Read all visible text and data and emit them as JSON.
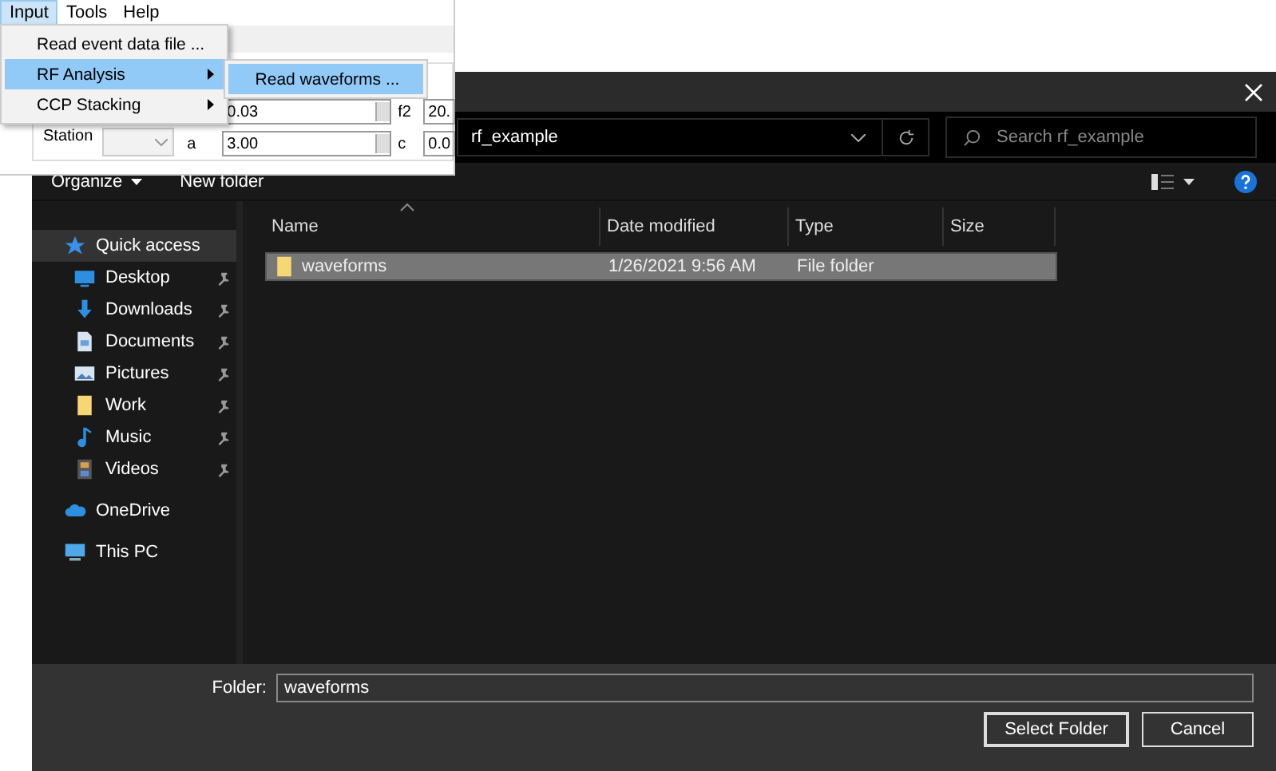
{
  "app_window": {
    "menu_bar": [
      {
        "label": "Input",
        "selected": true
      },
      {
        "label": "Tools",
        "selected": false
      },
      {
        "label": "Help",
        "selected": false
      }
    ],
    "station": {
      "label": "Station",
      "disabled": true
    },
    "fields": [
      {
        "value": "0.03"
      },
      {
        "label": "f2",
        "value": "20."
      },
      {
        "label": "a",
        "value": "3.00"
      },
      {
        "label": "c",
        "value": "0.0"
      }
    ]
  },
  "input_menu": {
    "items": [
      {
        "label": "Read event data file ...",
        "selected": false,
        "submenu": false
      },
      {
        "label": "RF Analysis",
        "selected": true,
        "submenu": true
      },
      {
        "label": "CCP Stacking",
        "selected": false,
        "submenu": true
      }
    ],
    "submenu_items": [
      {
        "label": "Read waveforms ...",
        "selected": true
      }
    ]
  },
  "dialog": {
    "address": "rf_example",
    "search": {
      "placeholder": "Search rf_example"
    },
    "toolbar": [
      {
        "label": "Organize",
        "kind": "dropdown"
      },
      {
        "label": "New folder",
        "kind": "button"
      }
    ],
    "sidebar": [
      {
        "label": "Quick access",
        "kind": "section",
        "selected": true,
        "pinned": false
      },
      {
        "label": "Desktop",
        "kind": "item",
        "selected": false,
        "pinned": true
      },
      {
        "label": "Downloads",
        "kind": "item",
        "selected": false,
        "pinned": true
      },
      {
        "label": "Documents",
        "kind": "item",
        "selected": false,
        "pinned": true
      },
      {
        "label": "Pictures",
        "kind": "item",
        "selected": false,
        "pinned": true
      },
      {
        "label": "Work",
        "kind": "item",
        "selected": false,
        "pinned": true
      },
      {
        "label": "Music",
        "kind": "item",
        "selected": false,
        "pinned": true
      },
      {
        "label": "Videos",
        "kind": "item",
        "selected": false,
        "pinned": true
      },
      {
        "label": "OneDrive",
        "kind": "section",
        "selected": false,
        "pinned": false
      },
      {
        "label": "This PC",
        "kind": "section",
        "selected": false,
        "pinned": false
      }
    ],
    "columns": [
      "Name",
      "Date modified",
      "Type",
      "Size"
    ],
    "rows": [
      {
        "name": "waveforms",
        "date": "1/26/2021 9:56 AM",
        "type": "File folder",
        "selected": true
      }
    ],
    "folder": {
      "label": "Folder:",
      "value": "waveforms"
    },
    "buttons": [
      "Select Folder",
      "Cancel"
    ]
  }
}
